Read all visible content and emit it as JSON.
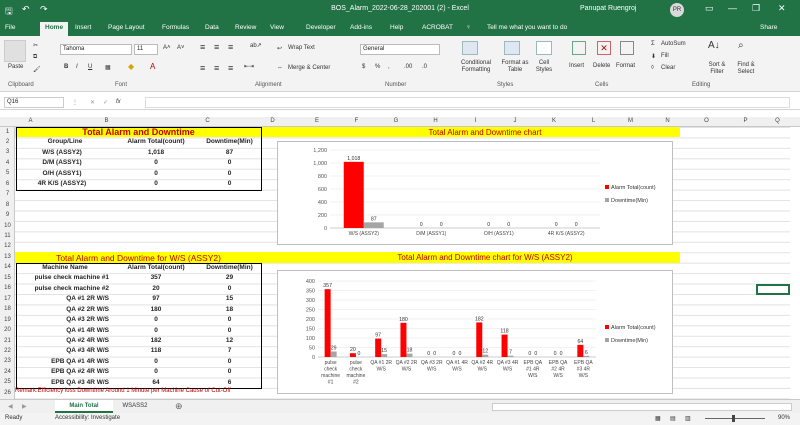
{
  "window": {
    "title": "BOS_Alarm_2022-06-28_202001 (2)  -  Excel",
    "user": "Panupat Ruengroj",
    "initials": "PR"
  },
  "tabs": [
    "File",
    "Home",
    "Insert",
    "Page Layout",
    "Formulas",
    "Data",
    "Review",
    "View",
    "Developer",
    "Add-ins",
    "Help",
    "ACROBAT"
  ],
  "tell_me": "Tell me what you want to do",
  "share": "Share",
  "ribbon": {
    "paste": "Paste",
    "font_name": "Tahoma",
    "font_size": "11",
    "wrap": "Wrap Text",
    "merge": "Merge & Center",
    "number_format": "General",
    "cond": "Conditional Formatting",
    "format_table": "Format as Table",
    "cell_styles": "Cell Styles",
    "insert": "Insert",
    "delete": "Delete",
    "format": "Format",
    "autosum": "AutoSum",
    "fill": "Fill",
    "clear": "Clear",
    "sort": "Sort & Filter",
    "find": "Find & Select",
    "groups": {
      "clipboard": "Clipboard",
      "font": "Font",
      "alignment": "Alignment",
      "number": "Number",
      "styles": "Styles",
      "cells": "Cells",
      "editing": "Editing"
    }
  },
  "formula_bar": {
    "name_box": "Q16",
    "fx": "fx",
    "value": ""
  },
  "columns": [
    "A",
    "B",
    "C",
    "D",
    "E",
    "F",
    "G",
    "H",
    "I",
    "J",
    "K",
    "L",
    "M",
    "N",
    "O",
    "P",
    "Q"
  ],
  "rows": [
    "1",
    "2",
    "3",
    "4",
    "5",
    "6",
    "7",
    "8",
    "9",
    "10",
    "11",
    "12",
    "13",
    "14",
    "15",
    "16",
    "17",
    "18",
    "19",
    "20",
    "21",
    "22",
    "23",
    "24",
    "25",
    "26"
  ],
  "table1": {
    "title": "Total Alarm and Downtime",
    "headers": [
      "Group/Line",
      "Alarm Total(count)",
      "Downtime(Min)"
    ],
    "rows": [
      [
        "W/S (ASSY2)",
        "1,018",
        "87"
      ],
      [
        "D/M (ASSY1)",
        "0",
        "0"
      ],
      [
        "O/H (ASSY1)",
        "0",
        "0"
      ],
      [
        "4R K/S (ASSY2)",
        "0",
        "0"
      ]
    ]
  },
  "table2": {
    "title": "Total Alarm and Downtime for W/S (ASSY2)",
    "headers": [
      "Machine Name",
      "Alarm Total(count)",
      "Downtime(Min)"
    ],
    "rows": [
      [
        "pulse check machine #1",
        "357",
        "29"
      ],
      [
        "pulse check machine #2",
        "20",
        "0"
      ],
      [
        "QA #1 2R W/S",
        "97",
        "15"
      ],
      [
        "QA #2 2R W/S",
        "180",
        "18"
      ],
      [
        "QA #3 2R W/S",
        "0",
        "0"
      ],
      [
        "QA #1 4R W/S",
        "0",
        "0"
      ],
      [
        "QA #2 4R W/S",
        "182",
        "12"
      ],
      [
        "QA #3 4R W/S",
        "118",
        "7"
      ],
      [
        "EPB QA #1 4R W/S",
        "0",
        "0"
      ],
      [
        "EPB QA #2 4R W/S",
        "0",
        "0"
      ],
      [
        "EPB QA #3 4R W/S",
        "64",
        "6"
      ]
    ]
  },
  "remark": "Remark:Efficiency loss Downtime Around 1 Minute per Machine Cause of Cut-Off",
  "chart_data": [
    {
      "type": "bar",
      "title": "Total Alarm and Downtime chart",
      "categories": [
        "W/S (ASSY2)",
        "D/M (ASSY1)",
        "O/H (ASSY1)",
        "4R K/S (ASSY2)"
      ],
      "series": [
        {
          "name": "Alarm Total(count)",
          "values": [
            1018,
            0,
            0,
            0
          ],
          "color": "#ff0000"
        },
        {
          "name": "Downtime(Min)",
          "values": [
            87,
            0,
            0,
            0
          ],
          "color": "#a5a5a5"
        }
      ],
      "ylim": [
        0,
        1200
      ],
      "yticks": [
        "0",
        "200",
        "400",
        "600",
        "800",
        "1,000",
        "1,200"
      ],
      "grid": true,
      "legend": "right"
    },
    {
      "type": "bar",
      "title": "Total Alarm and Downtime chart for W/S (ASSY2)",
      "categories": [
        "pulse check machine #1",
        "pulse check machine #2",
        "QA #1 2R W/S",
        "QA #2 2R W/S",
        "QA #3 2R W/S",
        "QA #1 4R W/S",
        "QA #2 4R W/S",
        "QA #3 4R W/S",
        "EPB QA #1 4R W/S",
        "EPB QA #2 4R W/S",
        "EPB QA #3 4R W/S"
      ],
      "category_lines": [
        [
          "pulse",
          "check",
          "machine",
          "#1"
        ],
        [
          "pulse",
          "check",
          "machine",
          "#2"
        ],
        [
          "QA #1 2R",
          "W/S"
        ],
        [
          "QA #2 2R",
          "W/S"
        ],
        [
          "QA #3 2R",
          "W/S"
        ],
        [
          "QA #1 4R",
          "W/S"
        ],
        [
          "QA #2 4R",
          "W/S"
        ],
        [
          "QA #3 4R",
          "W/S"
        ],
        [
          "EPB QA",
          "#1 4R",
          "W/S"
        ],
        [
          "EPB QA",
          "#2 4R",
          "W/S"
        ],
        [
          "EPB QA",
          "#3 4R",
          "W/S"
        ]
      ],
      "series": [
        {
          "name": "Alarm Total(count)",
          "values": [
            357,
            20,
            97,
            180,
            0,
            0,
            182,
            118,
            0,
            0,
            64
          ],
          "color": "#ff0000"
        },
        {
          "name": "Downtime(Min)",
          "values": [
            29,
            0,
            15,
            18,
            0,
            0,
            12,
            7,
            0,
            0,
            6
          ],
          "color": "#a5a5a5"
        }
      ],
      "ylim": [
        0,
        400
      ],
      "yticks": [
        "0",
        "50",
        "100",
        "150",
        "200",
        "250",
        "300",
        "350",
        "400"
      ],
      "grid": true,
      "legend": "right"
    }
  ],
  "sheets": [
    "Main Total",
    "WSASS2"
  ],
  "status": {
    "ready": "Ready",
    "accessibility": "Accessibility: Investigate",
    "zoom": "90%"
  }
}
